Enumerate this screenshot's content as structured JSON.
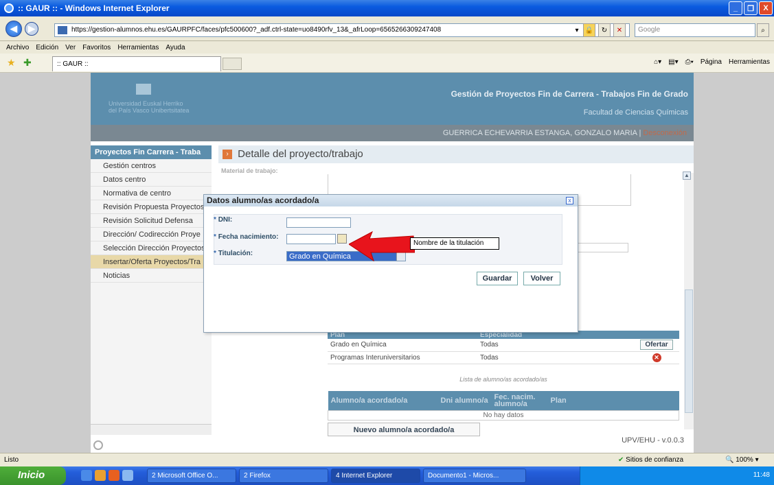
{
  "window": {
    "title": ":: GAUR :: - Windows Internet Explorer",
    "controls": [
      "_",
      "❐",
      "X"
    ]
  },
  "browser": {
    "url": "https://gestion-alumnos.ehu.es/GAURPFC/faces/pfc500600?_adf.ctrl-state=uo8490rfv_13&_afrLoop=6565266309247408",
    "search_placeholder": "Google",
    "menu": [
      "Archivo",
      "Edición",
      "Ver",
      "Favoritos",
      "Herramientas",
      "Ayuda"
    ],
    "tab_title": ":: GAUR ::",
    "right_tools": [
      "Página",
      "Herramientas"
    ]
  },
  "header": {
    "logo_line1": "Universidad   Euskal Herriko",
    "logo_line2": "del País Vasco   Unibertsitatea",
    "title": "Gestión de Proyectos Fin de Carrera - Trabajos Fin de Grado",
    "subtitle": "Facultad de Ciencias Químicas",
    "user": "GUERRICA ECHEVARRIA ESTANGA, GONZALO MARIA",
    "separator": "|",
    "logout": "Desconexión"
  },
  "sidebar": {
    "heading": "Proyectos Fin Carrera - Traba",
    "items": [
      {
        "label": "Gestión centros"
      },
      {
        "label": "Datos centro"
      },
      {
        "label": "Normativa de centro"
      },
      {
        "label": "Revisión Propuesta Proyectos"
      },
      {
        "label": "Revisión Solicitud Defensa"
      },
      {
        "label": "Dirección/ Codirección Proye"
      },
      {
        "label": "Selección Dirección Proyectos"
      },
      {
        "label": "Insertar/Oferta Proyectos/Tra"
      },
      {
        "label": "Noticias"
      }
    ]
  },
  "main": {
    "title": "Detalle del proyecto/trabajo",
    "faded_label": "Material de trabajo:",
    "plan_table": {
      "headers": [
        "Plan",
        "Especialidad",
        ""
      ],
      "rows": [
        {
          "plan": "Grado en Química",
          "esp": "Todas",
          "action": "Ofertar"
        },
        {
          "plan": "Programas Interuniversitarios",
          "esp": "Todas",
          "action": "✕"
        }
      ]
    },
    "students_caption": "Lista de alumno/as acordado/as",
    "students_table": {
      "headers": [
        "Alumno/a acordado/a",
        "Dni alumno/a",
        "Fec. nacim. alumno/a",
        "Plan"
      ],
      "empty": "No hay datos"
    },
    "new_student_button": "Nuevo alumno/a acordado/a",
    "version": "UPV/EHU - v.0.0.3"
  },
  "dialog": {
    "title": "Datos alumno/as acordado/a",
    "close": "x",
    "fields": {
      "dni_label": "DNI:",
      "dni_value": "",
      "fecha_label": "Fecha nacimiento:",
      "fecha_value": "",
      "titulacion_label": "Titulación:",
      "titulacion_value": "Grado en Química"
    },
    "required_mark": "*",
    "save": "Guardar",
    "back": "Volver"
  },
  "annotation": {
    "tooltip": "Nombre de la titulación",
    "arrow_color": "#e8141c"
  },
  "statusbar": {
    "text": "Listo",
    "zone": "Sitios de confianza",
    "zoom": "100%"
  },
  "taskbar": {
    "start": "Inicio",
    "tasks": [
      "2 Microsoft Office O...",
      "2 Firefox",
      "4 Internet Explorer",
      "Documento1 - Micros..."
    ],
    "clock": "11:48"
  }
}
